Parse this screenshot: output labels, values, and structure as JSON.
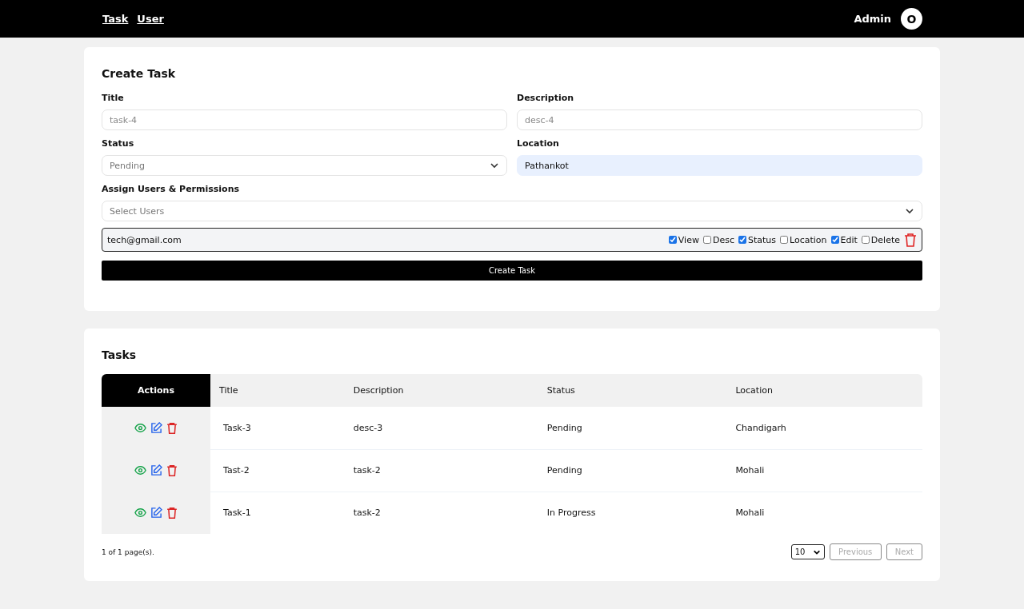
{
  "nav": {
    "links": [
      {
        "label": "Task"
      },
      {
        "label": "User"
      }
    ],
    "user_name": "Admin",
    "avatar_letter": "O"
  },
  "create_task": {
    "title": "Create Task",
    "fields": [
      {
        "kind": "text",
        "label": "Title",
        "placeholder": "task-4"
      },
      {
        "kind": "text",
        "label": "Description",
        "placeholder": "desc-4"
      },
      {
        "kind": "select",
        "label": "Status",
        "value": "Pending"
      },
      {
        "kind": "autofilled",
        "label": "Location",
        "value": "Pathankot"
      }
    ],
    "assign_label": "Assign Users & Permissions",
    "users_select": {
      "placeholder": "Select Users"
    },
    "assigned_users": [
      {
        "email": "tech@gmail.com",
        "permissions": [
          {
            "label": "View",
            "checked": true
          },
          {
            "label": "Desc",
            "checked": false
          },
          {
            "label": "Status",
            "checked": true
          },
          {
            "label": "Location",
            "checked": false
          },
          {
            "label": "Edit",
            "checked": true
          },
          {
            "label": "Delete",
            "checked": false
          }
        ]
      }
    ],
    "submit": "Create Task"
  },
  "tasks": {
    "title": "Tasks",
    "columns": [
      "Actions",
      "Title",
      "Description",
      "Status",
      "Location"
    ],
    "rows": [
      {
        "title": "Task-3",
        "description": "desc-3",
        "status": "Pending",
        "location": "Chandigarh"
      },
      {
        "title": "Tast-2",
        "description": "task-2",
        "status": "Pending",
        "location": "Mohali"
      },
      {
        "title": "Task-1",
        "description": "task-2",
        "status": "In Progress",
        "location": "Mohali"
      }
    ],
    "page_info": "1 of 1 page(s).",
    "page_size": "10",
    "pagination": [
      {
        "label": "Previous",
        "disabled": true
      },
      {
        "label": "Next",
        "disabled": true
      }
    ]
  }
}
